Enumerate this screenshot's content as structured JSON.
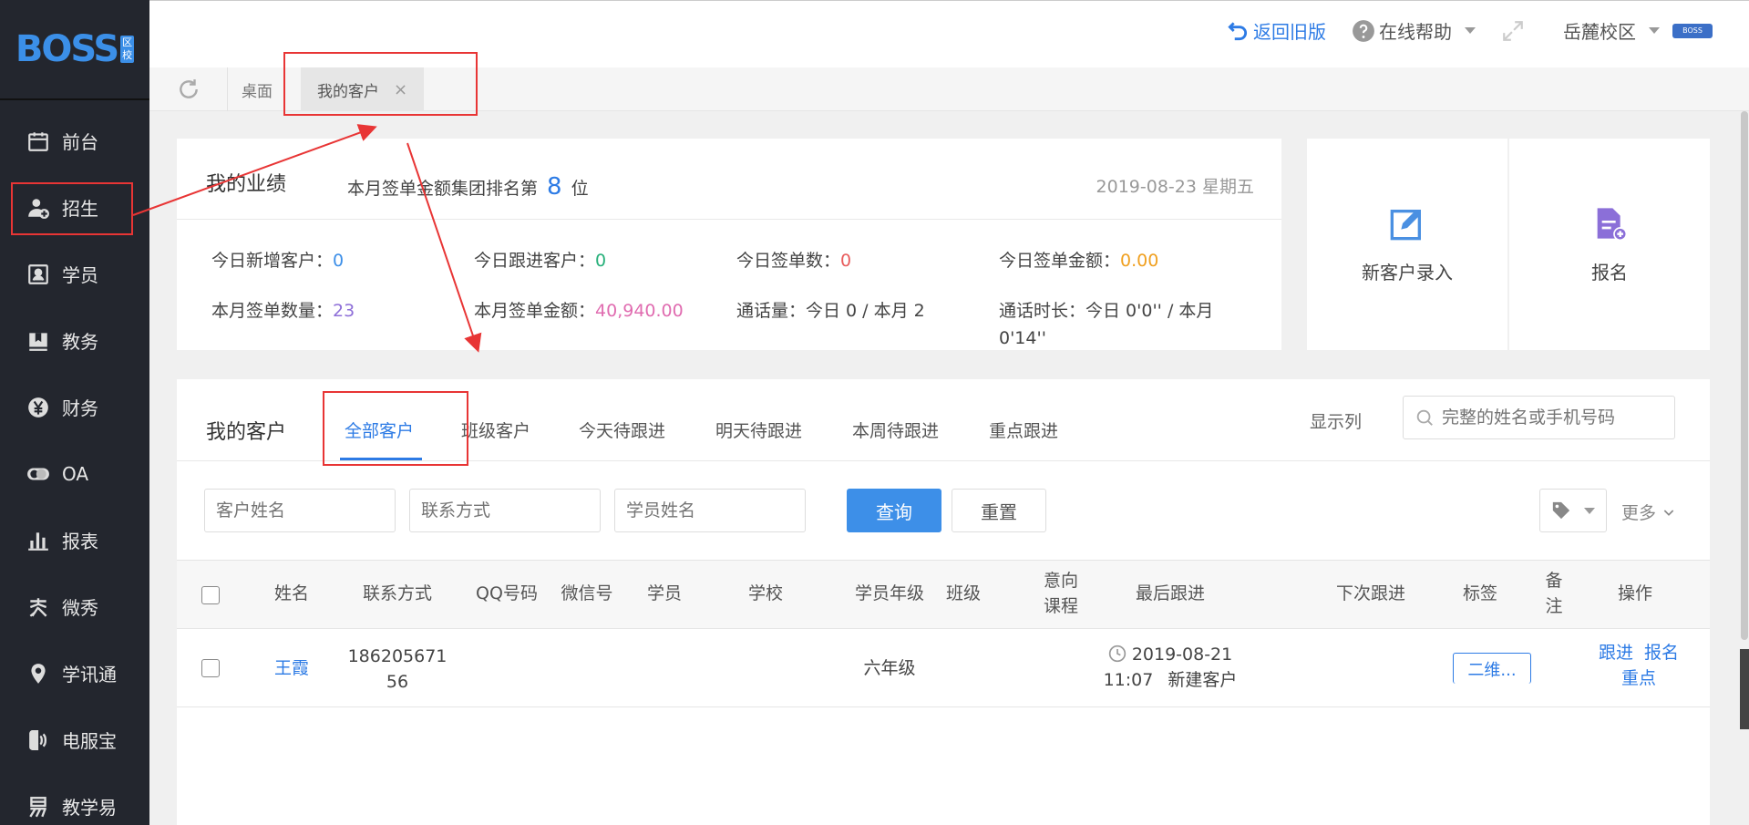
{
  "logo": {
    "text": "BOSS",
    "badge_top": "区",
    "badge_bottom": "校"
  },
  "sidebar": {
    "items": [
      {
        "label": "前台",
        "icon": "calendar-icon"
      },
      {
        "label": "招生",
        "icon": "add-user-icon"
      },
      {
        "label": "学员",
        "icon": "id-card-icon"
      },
      {
        "label": "教务",
        "icon": "book-icon"
      },
      {
        "label": "财务",
        "icon": "yen-icon"
      },
      {
        "label": "OA",
        "icon": "toggle-icon"
      },
      {
        "label": "报表",
        "icon": "bar-chart-icon"
      },
      {
        "label": "微秀",
        "icon": "show-icon"
      },
      {
        "label": "学讯通",
        "icon": "location-icon"
      },
      {
        "label": "电服宝",
        "icon": "phone-icon"
      },
      {
        "label": "教学易",
        "icon": "teach-icon"
      }
    ]
  },
  "header": {
    "back_old": "返回旧版",
    "help": "在线帮助",
    "campus": "岳麓校区",
    "campus_badge": "BOSS"
  },
  "tabs": {
    "desktop": "桌面",
    "active": "我的客户",
    "close": "×"
  },
  "performance": {
    "title": "我的业绩",
    "rank_prefix": "本月签单金额集团排名第",
    "rank_value": "8",
    "rank_suffix": "位",
    "date": "2019-08-23 星期五",
    "stats": [
      {
        "label": "今日新增客户：",
        "value": "0",
        "color": "#3d8fe8"
      },
      {
        "label": "今日跟进客户：",
        "value": "0",
        "color": "#27b07a"
      },
      {
        "label": "今日签单数：",
        "value": "0",
        "color": "#e85c5c"
      },
      {
        "label": "今日签单金额：",
        "value": "0.00",
        "color": "#f0a020"
      },
      {
        "label": "本月签单数量：",
        "value": "23",
        "color": "#8e6fd8"
      },
      {
        "label": "本月签单金额：",
        "value": "40,940.00",
        "color": "#e06cb0"
      },
      {
        "label": "通话量：",
        "value": "今日 0 / 本月 2",
        "color": "#444"
      },
      {
        "label": "通话时长：",
        "value": "今日 0'0'' / 本月 0'14''",
        "color": "#444"
      }
    ]
  },
  "quick": {
    "new_customer": "新客户录入",
    "register": "报名"
  },
  "customers": {
    "title": "我的客户",
    "tabs": [
      "全部客户",
      "班级客户",
      "今天待跟进",
      "明天待跟进",
      "本周待跟进",
      "重点跟进"
    ],
    "show_columns": "显示列",
    "search_placeholder": "完整的姓名或手机号码",
    "filters": {
      "customer_name": "客户姓名",
      "contact": "联系方式",
      "student_name": "学员姓名"
    },
    "query": "查询",
    "reset": "重置",
    "more": "更多",
    "columns": [
      "姓名",
      "联系方式",
      "QQ号码",
      "微信号",
      "学员",
      "学校",
      "学员年级",
      "班级",
      "意向课程",
      "最后跟进",
      "下次跟进",
      "标签",
      "备注",
      "操作"
    ],
    "rows": [
      {
        "name": "王霞",
        "phone": "18620567156",
        "grade": "六年级",
        "last_follow_date": "2019-08-21",
        "last_follow_time": "11:07",
        "last_follow_note": "新建客户",
        "tag": "二维...",
        "actions": [
          "跟进",
          "报名",
          "重点"
        ]
      }
    ]
  }
}
